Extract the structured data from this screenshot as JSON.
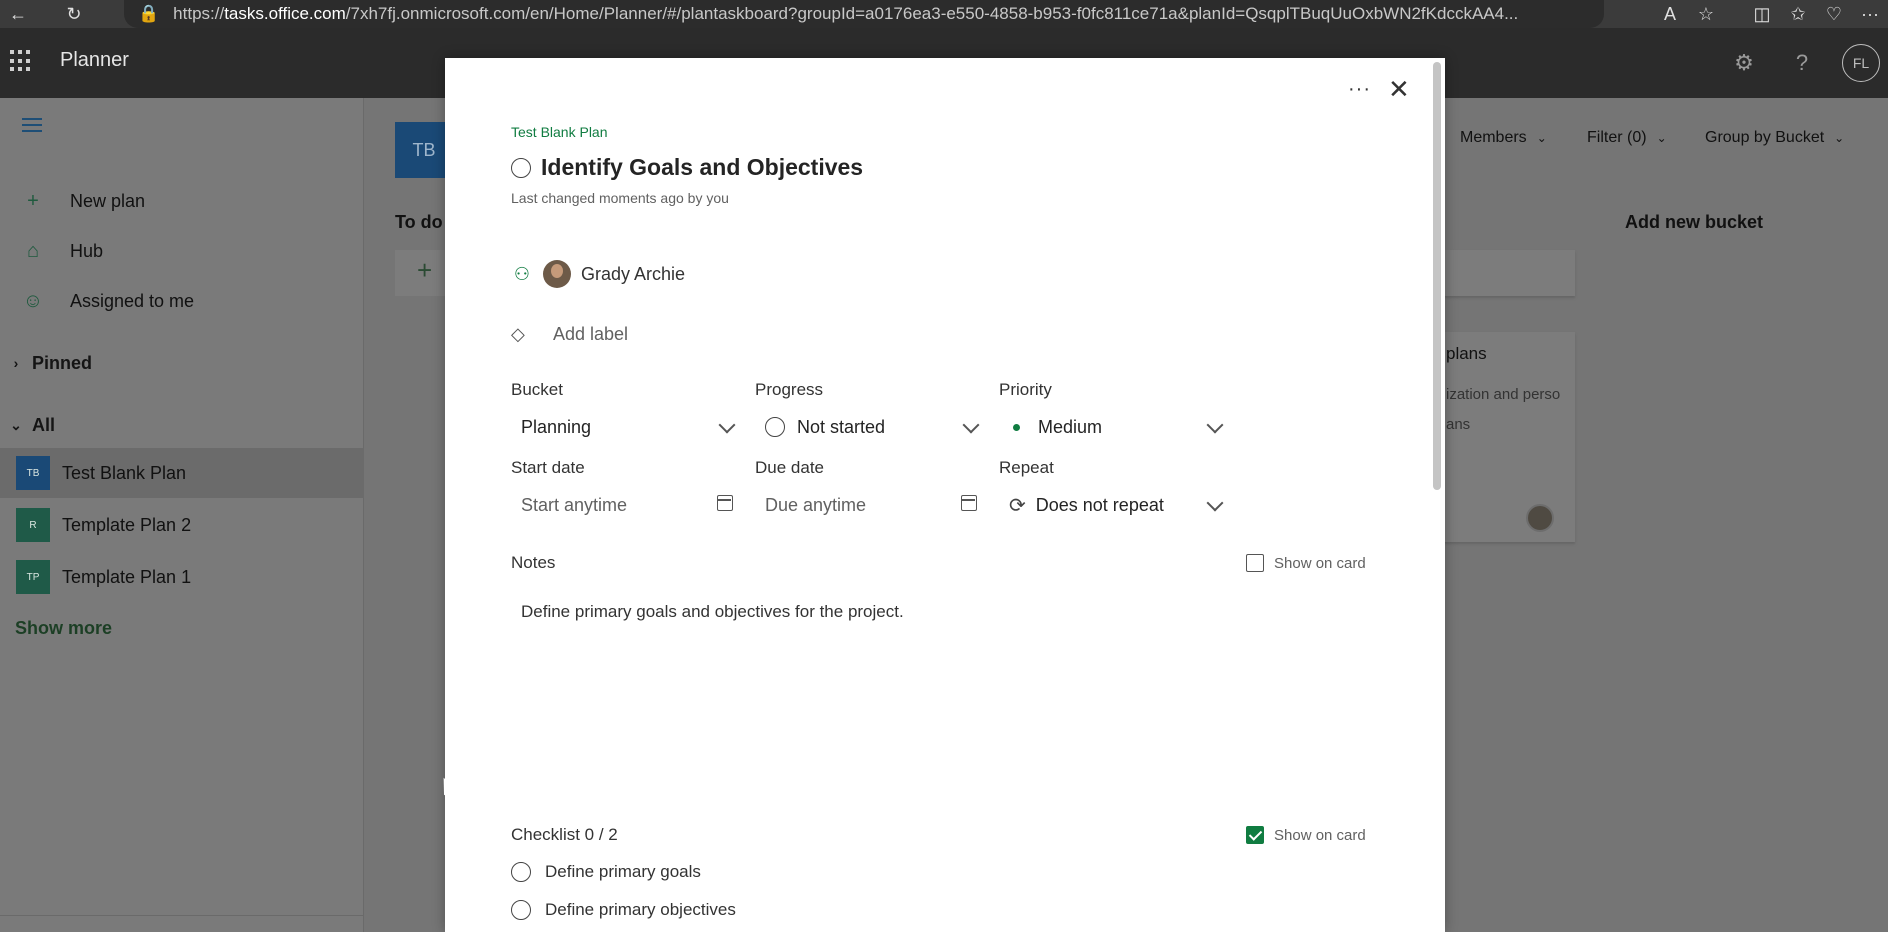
{
  "browser": {
    "url_prefix": "https://",
    "url_host": "tasks.office.com",
    "url_rest": "/7xh7fj.onmicrosoft.com/en/Home/Planner/#/plantaskboard?groupId=a0176ea3-e550-4858-b953-f0fc811ce71a&planId=QsqplTBuqUuOxbWN2fKdcckAA4..."
  },
  "suite": {
    "app_name": "Planner",
    "user_initials": "FL"
  },
  "nav": {
    "new_plan": "New plan",
    "hub": "Hub",
    "assigned": "Assigned to me",
    "pinned": "Pinned",
    "all": "All",
    "plans": [
      {
        "tile": "TB",
        "name": "Test Blank Plan",
        "color": "#1a4976"
      },
      {
        "tile": "R",
        "name": "Template Plan 2",
        "color": "#1f5a48"
      },
      {
        "tile": "TP",
        "name": "Template Plan 1",
        "color": "#1f5a48"
      }
    ],
    "show_more": "Show more"
  },
  "board": {
    "tile": "TB",
    "bucket_todo": "To do",
    "members": "Members",
    "filter": "Filter (0)",
    "group_by": "Group by Bucket",
    "add_bucket": "Add new bucket",
    "card_title": "plans",
    "card_text_1": "ization and perso",
    "card_text_2": "ans"
  },
  "task": {
    "plan_name": "Test Blank Plan",
    "title": "Identify Goals and Objectives",
    "last_changed": "Last changed moments ago by you",
    "assignee": "Grady Archie",
    "add_label": "Add label",
    "bucket_label": "Bucket",
    "bucket_value": "Planning",
    "progress_label": "Progress",
    "progress_value": "Not started",
    "priority_label": "Priority",
    "priority_value": "Medium",
    "start_label": "Start date",
    "start_placeholder": "Start anytime",
    "due_label": "Due date",
    "due_placeholder": "Due anytime",
    "repeat_label": "Repeat",
    "repeat_value": "Does not repeat",
    "notes_label": "Notes",
    "notes_show_on_card": "Show on card",
    "notes_text": "Define primary goals and objectives for the project.",
    "checklist_label": "Checklist 0 / 2",
    "checklist_show_on_card": "Show on card",
    "checklist": [
      "Define primary goals",
      "Define primary objectives"
    ]
  },
  "colors": {
    "accent": "#107c41",
    "plan_blue": "#1a4976"
  }
}
